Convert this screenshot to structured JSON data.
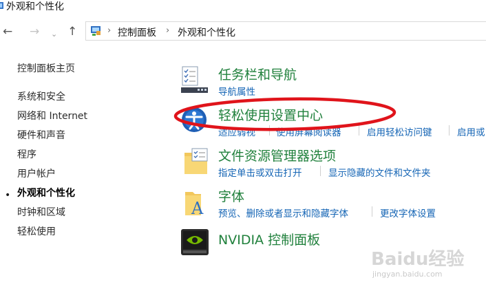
{
  "window": {
    "title": "外观和个性化"
  },
  "nav": {
    "back_icon": "←",
    "forward_icon": "→",
    "history_icon": "⌄",
    "up_icon": "↑",
    "breadcrumb": [
      "控制面板",
      "外观和个性化"
    ],
    "separator": "›"
  },
  "sidebar": {
    "home": "控制面板主页",
    "items": [
      "系统和安全",
      "网络和 Internet",
      "硬件和声音",
      "程序",
      "用户帐户",
      "外观和个性化",
      "时钟和区域",
      "轻松使用"
    ],
    "active_index": 5,
    "bullet": "•"
  },
  "sections": [
    {
      "title": "任务栏和导航",
      "links": [
        "导航属性"
      ]
    },
    {
      "title": "轻松使用设置中心",
      "links": [
        "适应弱视",
        "使用屏幕阅读器",
        "启用轻松访问键",
        "启用或"
      ]
    },
    {
      "title": "文件资源管理器选项",
      "links": [
        "指定单击或双击打开",
        "显示隐藏的文件和文件夹"
      ]
    },
    {
      "title": "字体",
      "links": [
        "预览、删除或者显示和隐藏字体",
        "更改字体设置"
      ]
    },
    {
      "title": "NVIDIA 控制面板",
      "links": []
    }
  ],
  "icons": {
    "taskbar": "taskbar-icon",
    "ease": "ease-of-access-icon",
    "explorer": "folder-options-icon",
    "fonts": "fonts-folder-icon",
    "nvidia": "nvidia-icon"
  },
  "annotation": {
    "color": "#e0141b"
  },
  "watermark": {
    "text": "Baidu经验",
    "subtext": "jingyan.baidu.com"
  }
}
